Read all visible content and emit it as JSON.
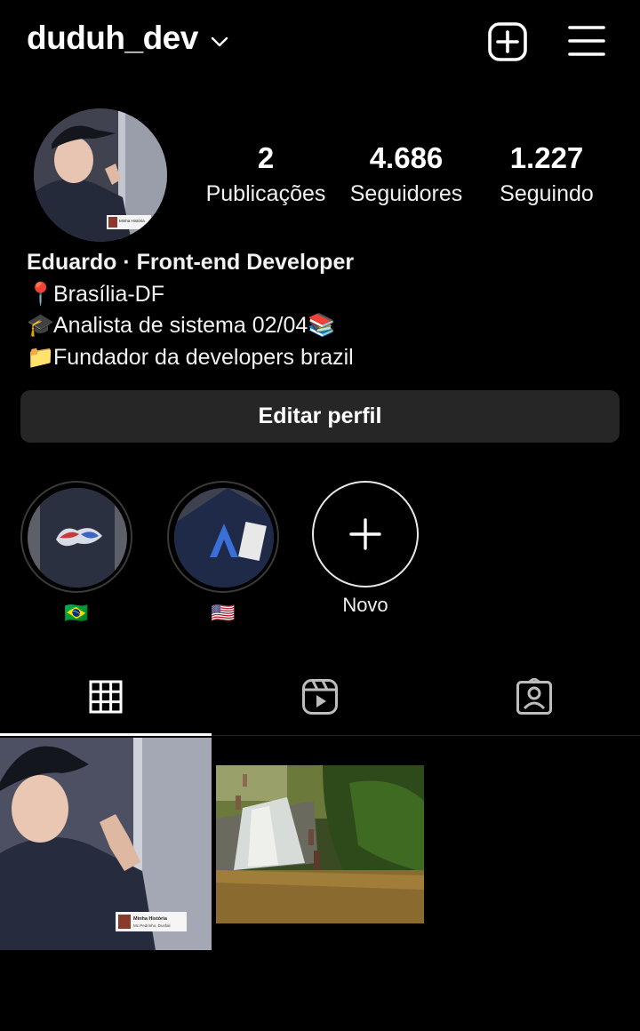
{
  "header": {
    "username": "duduh_dev",
    "icons": [
      "chevron-down-icon",
      "add-square-icon",
      "hamburger-menu-icon"
    ]
  },
  "profile": {
    "avatar_icon": "profile-photo",
    "avatar_caption": "Minha História",
    "stats": [
      {
        "value": "2",
        "label": "Publicações"
      },
      {
        "value": "4.686",
        "label": "Seguidores"
      },
      {
        "value": "1.227",
        "label": "Seguindo"
      }
    ],
    "bio": {
      "name": "Eduardo · Front-end Developer",
      "lines": [
        {
          "emoji": "📍",
          "text": "Brasília-DF"
        },
        {
          "emoji": "🎓",
          "text": "Analista de sistema 02/04",
          "trailing_emoji": "📚"
        },
        {
          "emoji": "📁",
          "text": "Fundador da developers brazil"
        }
      ]
    },
    "edit_button": "Editar perfil"
  },
  "highlights": [
    {
      "label": "🇧🇷",
      "icon": "brazil-flag"
    },
    {
      "label": "🇺🇸",
      "icon": "usa-flag"
    }
  ],
  "new_highlight": {
    "label": "Novo",
    "icon": "plus-icon"
  },
  "tabs": [
    {
      "name": "posts",
      "icon": "grid-icon",
      "active": true
    },
    {
      "name": "reels",
      "icon": "reels-icon",
      "active": false
    },
    {
      "name": "tagged",
      "icon": "tagged-person-icon",
      "active": false
    }
  ],
  "posts": [
    {
      "type": "photo",
      "caption_title": "Minha História",
      "caption_sub": "Mc Pedrinho, Dusfali"
    },
    {
      "type": "photo",
      "subject": "waterfall"
    }
  ],
  "colors": {
    "background": "#000000",
    "button_bg": "#262626",
    "text": "#f5f5f5"
  }
}
